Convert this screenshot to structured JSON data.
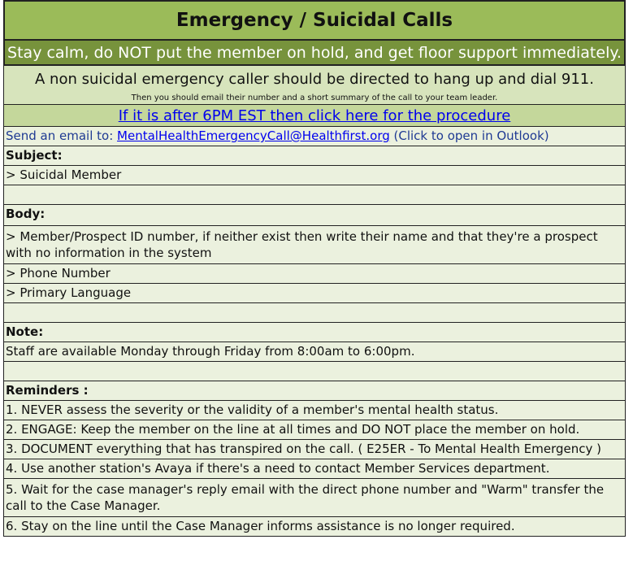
{
  "title": "Emergency / Suicidal Calls",
  "banner": "Stay calm, do NOT put the member on hold, and get floor support immediately.",
  "non_suicidal": {
    "line1": "A non suicidal emergency caller should be directed to hang up and dial 911.",
    "line2": "Then you should email their number and a short summary of the call to your team leader."
  },
  "after_6pm_link": "If it is after 6PM EST then click here for the procedure",
  "email": {
    "prefix": "Send an email to: ",
    "address": "MentalHealthEmergencyCall@Healthfirst.org",
    "suffix": " (Click to open in Outlook)"
  },
  "subject": {
    "heading": "Subject:",
    "value": "> Suicidal Member"
  },
  "body": {
    "heading": "Body:",
    "items": [
      "> Member/Prospect ID number, if neither exist then write their name and that they're a prospect with no information in the system",
      "> Phone Number",
      "> Primary Language"
    ]
  },
  "note": {
    "heading": "Note:",
    "text": "Staff are available Monday through Friday from 8:00am to 6:00pm."
  },
  "reminders": {
    "heading": "Reminders :",
    "items": [
      "1. NEVER assess the severity or the validity of a member's mental health status.",
      "2. ENGAGE: Keep the member on the line at all times and DO NOT place the member on hold.",
      "3. DOCUMENT everything that has transpired on the call. ( E25ER - To Mental Health Emergency )",
      "4. Use another station's Avaya if there's a need to contact Member Services department.",
      "5. Wait for the case manager's reply email with the direct phone number and \"Warm\" transfer the call to the Case Manager.",
      "6. Stay on the line until the Case Manager informs assistance is no longer required."
    ]
  },
  "colors": {
    "title_bg": "#9bbb59",
    "banner_bg": "#77933c",
    "note_bg": "#d7e4bc",
    "link_row_bg": "#c4d79b",
    "cell_bg": "#ebf1de",
    "link": "#0000ee"
  }
}
